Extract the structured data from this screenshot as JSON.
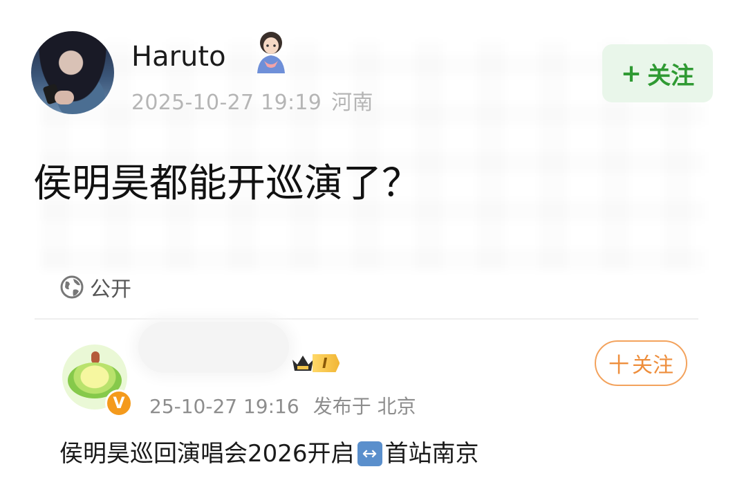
{
  "post": {
    "author": "Haruto",
    "timestamp": "2025-10-27 19:19",
    "location": "河南",
    "follow_plus": "+",
    "follow_label": "关注",
    "content": "侯明昊都能开巡演了？",
    "visibility": "公开"
  },
  "quote": {
    "level": "I",
    "verified_mark": "V",
    "timestamp": "25-10-27 19:16",
    "published_at": "发布于 北京",
    "follow_plus": "十",
    "follow_label": "关注",
    "text_before": "侯明昊巡回演唱会2026开启",
    "emoji": "↔",
    "text_after": "首站南京"
  },
  "colors": {
    "follow_green": "#2f9a33",
    "follow_green_bg": "#e9f6ea",
    "follow_orange": "#ee8e3c",
    "meta_gray": "#b5b5b5",
    "verified_orange": "#f49a1c"
  },
  "icons": {
    "visibility": "globe-icon",
    "author_badge": "girl-sticker-icon",
    "level_badge": "crown-icon"
  }
}
